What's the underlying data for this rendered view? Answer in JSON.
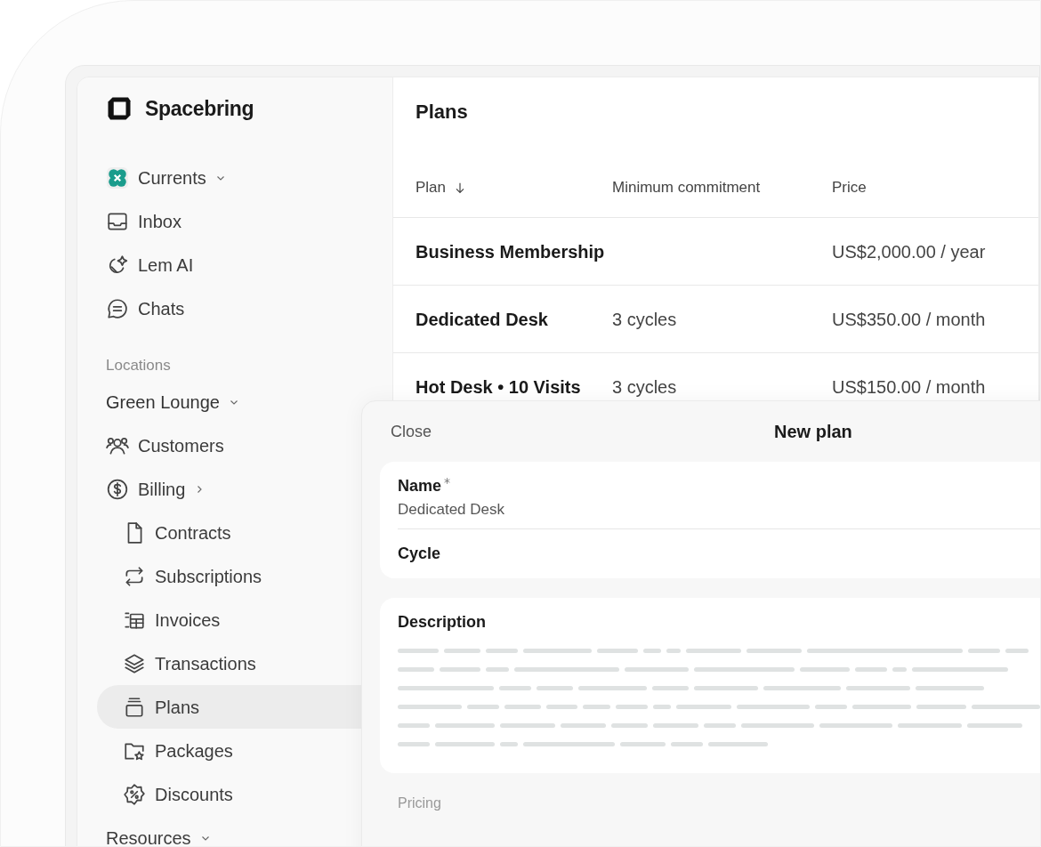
{
  "brand": {
    "name": "Spacebring"
  },
  "sidebar": {
    "items": [
      {
        "kind": "workspace",
        "label": "Currents",
        "dropdown": true,
        "submenu": false
      },
      {
        "kind": "link",
        "label": "Inbox",
        "dropdown": false,
        "submenu": false
      },
      {
        "kind": "link",
        "label": "Lem AI",
        "dropdown": false,
        "submenu": false
      },
      {
        "kind": "link",
        "label": "Chats",
        "dropdown": false,
        "submenu": false
      },
      {
        "kind": "section",
        "label": "Locations"
      },
      {
        "kind": "location",
        "label": "Green Lounge",
        "dropdown": true,
        "submenu": false
      },
      {
        "kind": "link",
        "label": "Customers",
        "dropdown": false,
        "submenu": false
      },
      {
        "kind": "link",
        "label": "Billing",
        "dropdown": false,
        "submenu": true,
        "children": [
          {
            "label": "Contracts",
            "selected": false
          },
          {
            "label": "Subscriptions",
            "selected": false
          },
          {
            "label": "Invoices",
            "selected": false
          },
          {
            "label": "Transactions",
            "selected": false
          },
          {
            "label": "Plans",
            "selected": true
          },
          {
            "label": "Packages",
            "selected": false
          },
          {
            "label": "Discounts",
            "selected": false
          }
        ]
      },
      {
        "kind": "link",
        "label": "Resources",
        "dropdown": true,
        "submenu": false
      }
    ]
  },
  "page": {
    "title": "Plans"
  },
  "table": {
    "columns": [
      {
        "label": "Plan",
        "sorted": true
      },
      {
        "label": "Minimum commitment",
        "sorted": false
      },
      {
        "label": "Price",
        "sorted": false
      }
    ],
    "rows": [
      [
        "Business Membership",
        "",
        "US$2,000.00 / year"
      ],
      [
        "Dedicated Desk",
        "3 cycles",
        "US$350.00 / month"
      ],
      [
        "Hot Desk • 10 Visits",
        "3 cycles",
        "US$150.00 / month"
      ]
    ]
  },
  "modal": {
    "close": "Close",
    "title": "New plan",
    "fields": [
      {
        "label": "Name",
        "required": true,
        "value": "Dedicated Desk"
      },
      {
        "label": "Cycle",
        "required": false
      }
    ],
    "description": {
      "label": "Description"
    },
    "section": "Pricing"
  }
}
